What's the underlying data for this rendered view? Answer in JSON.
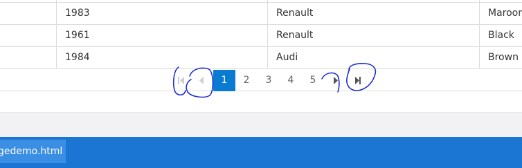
{
  "table": {
    "rows": [
      {
        "year": "1983",
        "make": "Renault",
        "color": "Maroon"
      },
      {
        "year": "1961",
        "make": "Renault",
        "color": "Black"
      },
      {
        "year": "1984",
        "make": "Audi",
        "color": "Brown"
      }
    ]
  },
  "pager": {
    "first_icon": "first-page-icon",
    "prev_icon": "previous-page-icon",
    "next_icon": "next-page-icon",
    "last_icon": "last-page-icon",
    "pages": [
      "1",
      "2",
      "3",
      "4",
      "5"
    ],
    "current_page": "1"
  },
  "taskbar": {
    "tab_label": "gedemo.html"
  },
  "colors": {
    "accent": "#0a7bd3",
    "taskbar": "#1a76d2",
    "annotation_ink": "#1f2fd0"
  }
}
